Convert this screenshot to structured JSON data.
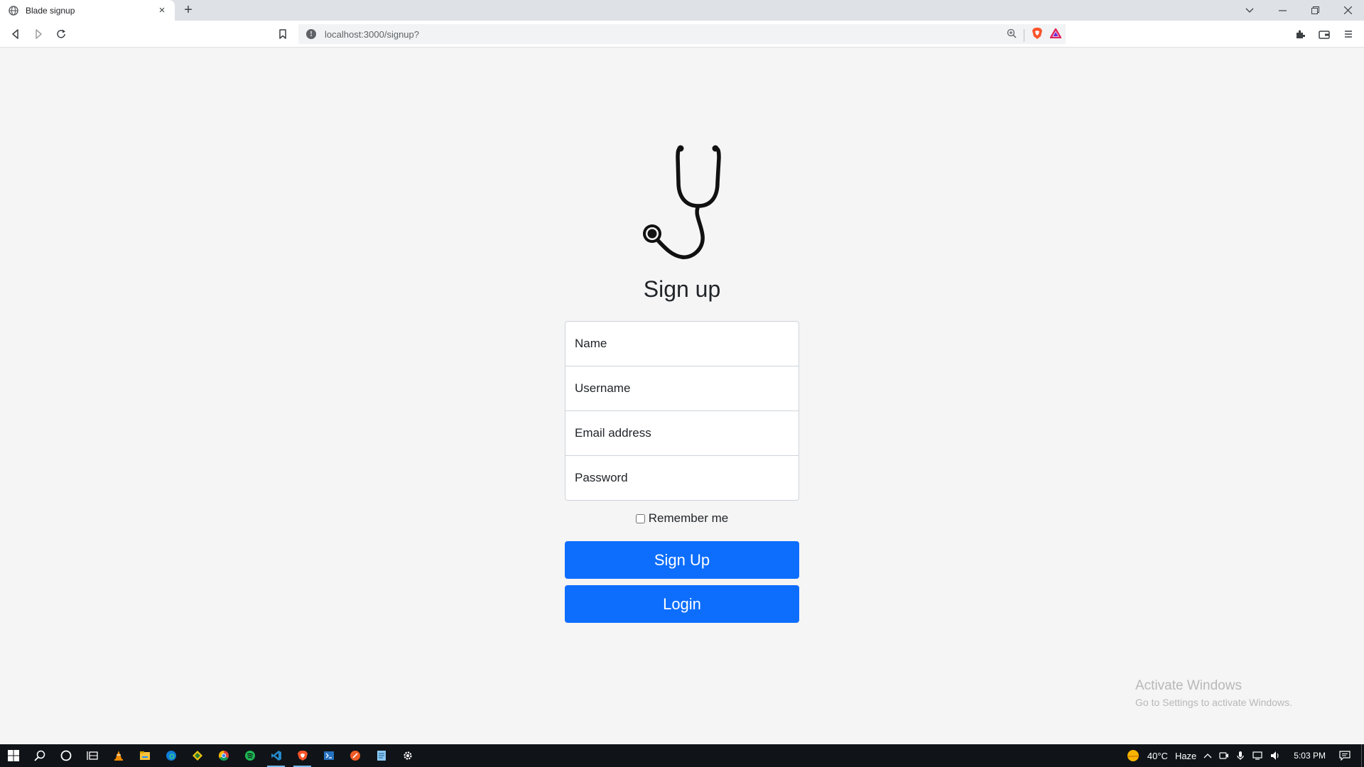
{
  "browser": {
    "tab_title": "Blade signup",
    "tab_close": "×",
    "new_tab": "+",
    "url": "localhost:3000/signup?"
  },
  "page": {
    "heading": "Sign up",
    "fields": {
      "name_placeholder": "Name",
      "username_placeholder": "Username",
      "email_placeholder": "Email address",
      "password_placeholder": "Password"
    },
    "remember_label": "Remember me",
    "signup_button": "Sign Up",
    "login_button": "Login"
  },
  "watermark": {
    "line1": "Activate Windows",
    "line2": "Go to Settings to activate Windows."
  },
  "taskbar": {
    "weather_temp": "40°C",
    "weather_desc": "Haze",
    "time": "5:03 PM",
    "apps": [
      "windows-start",
      "search",
      "cortana",
      "task-view",
      "vlc",
      "file-explorer",
      "edge",
      "git",
      "chrome",
      "spotify",
      "vscode",
      "brave",
      "powershell",
      "postman",
      "notepad",
      "settings"
    ]
  },
  "colors": {
    "primary_button": "#0d6efd",
    "page_background": "#f5f5f5",
    "taskbar": "#101418"
  }
}
